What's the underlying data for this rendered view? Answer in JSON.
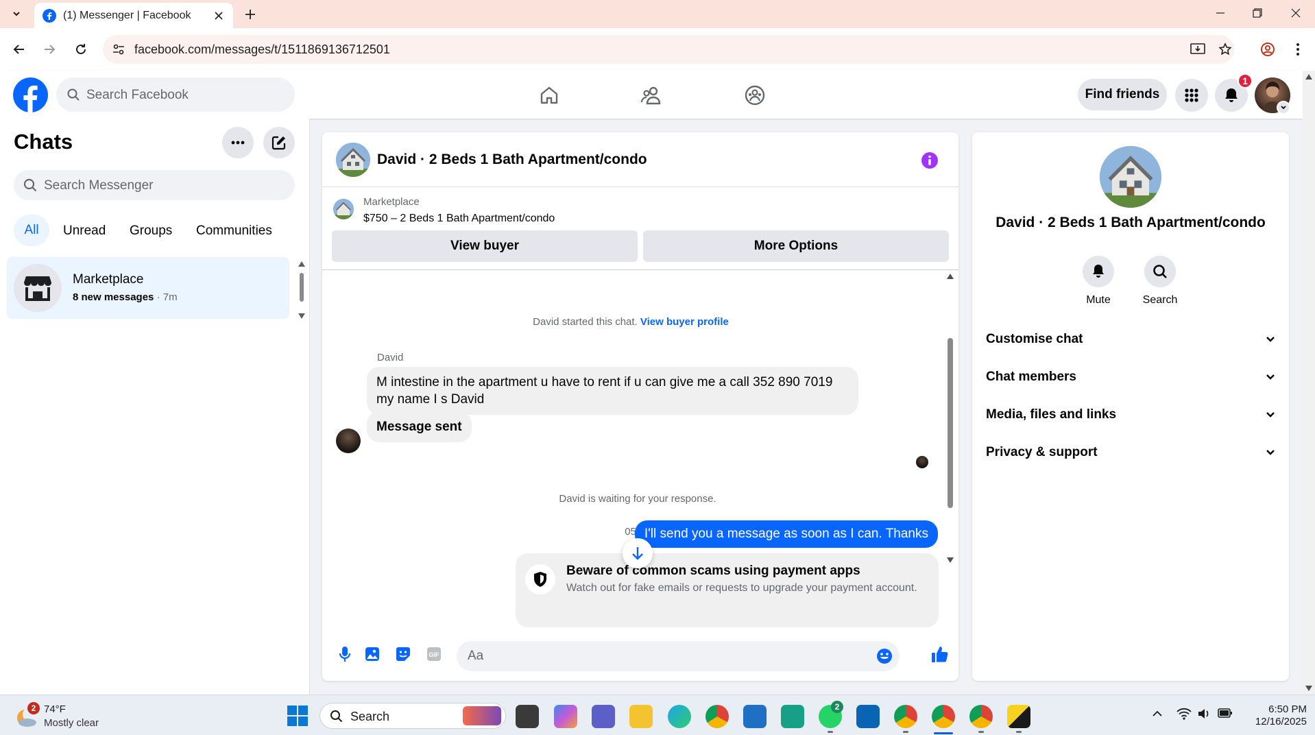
{
  "browser": {
    "tab_title": "(1) Messenger | Facebook",
    "url": "facebook.com/messages/t/1511869136712501"
  },
  "facebook": {
    "search_placeholder": "Search Facebook",
    "find_friends": "Find friends",
    "notification_count": "1"
  },
  "sidebar": {
    "title": "Chats",
    "search_placeholder": "Search Messenger",
    "filters": [
      "All",
      "Unread",
      "Groups",
      "Communities"
    ],
    "chat": {
      "name": "Marketplace",
      "preview": "8 new messages",
      "time": "· 7m"
    }
  },
  "conversation": {
    "title": "David · 2 Beds 1 Bath Apartment/condo",
    "marketplace_label": "Marketplace",
    "listing": "$750 – 2 Beds 1 Bath Apartment/condo",
    "view_buyer": "View buyer",
    "more_options": "More Options",
    "started_text": "David started this chat.",
    "started_link": "View buyer profile",
    "sender_name": "David",
    "message_1": "M intestine in the apartment u have to rent if u can give me a call 352 890 7019 my name I s David",
    "message_2": "Message sent",
    "waiting_text": "David is waiting for your response.",
    "timestamp": "05:40",
    "reply": "I'll send you a message as soon as I can. Thanks",
    "warning_title": "Beware of common scams using payment apps",
    "warning_body": "Watch out for fake emails or requests to upgrade your payment account.",
    "composer_placeholder": "Aa"
  },
  "details": {
    "name": "David · 2 Beds 1 Bath Apartment/condo",
    "mute": "Mute",
    "search": "Search",
    "sections": [
      "Customise chat",
      "Chat members",
      "Media, files and links",
      "Privacy & support"
    ]
  },
  "taskbar": {
    "weather_badge": "2",
    "temperature": "74°F",
    "condition": "Mostly clear",
    "search": "Search",
    "whatsapp_badge": "2",
    "time": "6:50 PM",
    "date": "12/16/2025"
  },
  "colors": {
    "facebook_blue": "#0866ff",
    "chrome_tab_strip": "#fbe3dc",
    "messenger_purple": "#a033ff"
  }
}
